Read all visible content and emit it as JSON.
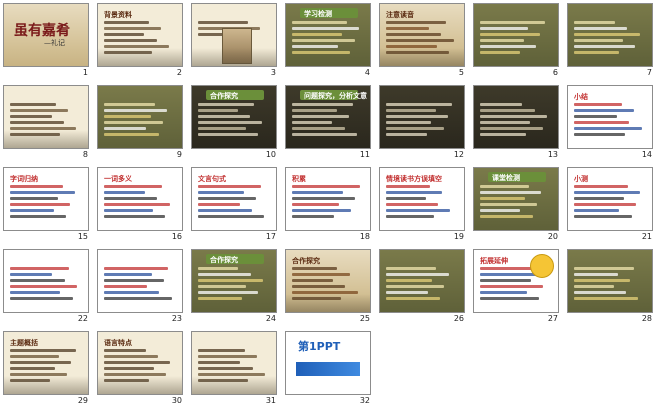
{
  "slides": [
    {
      "n": "1",
      "title": "虽有嘉肴",
      "subtitle": "—礼记",
      "bg": "scroll",
      "kind": "cover"
    },
    {
      "n": "2",
      "title": "背景资料",
      "bg": "paper",
      "kind": "text"
    },
    {
      "n": "3",
      "title": "",
      "bg": "paper",
      "kind": "photo"
    },
    {
      "n": "4",
      "title": "学习检测",
      "bg": "olive",
      "kind": "text"
    },
    {
      "n": "5",
      "title": "注意读音",
      "bg": "scroll",
      "kind": "text"
    },
    {
      "n": "6",
      "title": "",
      "bg": "olive",
      "kind": "text"
    },
    {
      "n": "7",
      "title": "",
      "bg": "olive",
      "kind": "text"
    },
    {
      "n": "8",
      "title": "",
      "bg": "paper",
      "kind": "text"
    },
    {
      "n": "9",
      "title": "",
      "bg": "olive",
      "kind": "text"
    },
    {
      "n": "10",
      "title": "合作探究",
      "bg": "dark",
      "kind": "text"
    },
    {
      "n": "11",
      "title": "问题探究，分析文意",
      "bg": "dark",
      "kind": "text"
    },
    {
      "n": "12",
      "title": "",
      "bg": "dark",
      "kind": "text"
    },
    {
      "n": "13",
      "title": "",
      "bg": "dark",
      "kind": "text"
    },
    {
      "n": "14",
      "title": "小结",
      "bg": "white",
      "kind": "text"
    },
    {
      "n": "15",
      "title": "字词归纳",
      "bg": "white",
      "kind": "text"
    },
    {
      "n": "16",
      "title": "一词多义",
      "bg": "white",
      "kind": "text"
    },
    {
      "n": "17",
      "title": "文言句式",
      "bg": "white",
      "kind": "text"
    },
    {
      "n": "18",
      "title": "积累",
      "bg": "white",
      "kind": "text"
    },
    {
      "n": "19",
      "title": "情境读书方误填空",
      "bg": "white",
      "kind": "text"
    },
    {
      "n": "20",
      "title": "课堂检测",
      "bg": "olive",
      "kind": "text"
    },
    {
      "n": "21",
      "title": "小测",
      "bg": "white",
      "kind": "text"
    },
    {
      "n": "22",
      "title": "",
      "bg": "white",
      "kind": "text"
    },
    {
      "n": "23",
      "title": "",
      "bg": "white",
      "kind": "text"
    },
    {
      "n": "24",
      "title": "合作探究",
      "bg": "olive",
      "kind": "text"
    },
    {
      "n": "25",
      "title": "合作探究",
      "bg": "scroll",
      "kind": "text"
    },
    {
      "n": "26",
      "title": "",
      "bg": "olive",
      "kind": "text"
    },
    {
      "n": "27",
      "title": "拓展延伸",
      "bg": "white",
      "kind": "smile"
    },
    {
      "n": "28",
      "title": "",
      "bg": "olive",
      "kind": "text"
    },
    {
      "n": "29",
      "title": "主题概括",
      "bg": "paper",
      "kind": "text"
    },
    {
      "n": "30",
      "title": "语言特点",
      "bg": "paper",
      "kind": "text"
    },
    {
      "n": "31",
      "title": "",
      "bg": "paper",
      "kind": "text"
    },
    {
      "n": "32",
      "title": "第1PPT",
      "bg": "white",
      "kind": "logo"
    }
  ]
}
